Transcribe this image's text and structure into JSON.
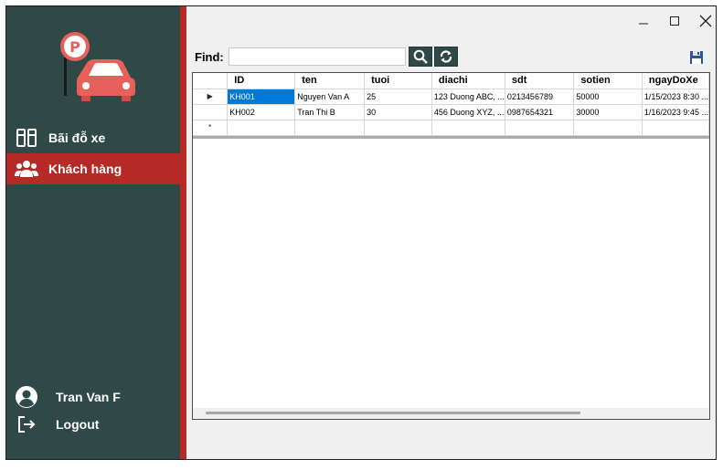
{
  "sidebar": {
    "items": [
      {
        "label": "Bãi đỗ xe",
        "icon": "parking-lot-icon",
        "active": false
      },
      {
        "label": "Khách hàng",
        "icon": "customers-icon",
        "active": true
      }
    ],
    "user_name": "Tran Van F",
    "logout_label": "Logout"
  },
  "toolbar": {
    "find_label": "Find:",
    "find_value": "",
    "search_icon": "search-icon",
    "refresh_icon": "refresh-icon",
    "save_icon": "save-icon"
  },
  "grid": {
    "columns": [
      "ID",
      "ten",
      "tuoi",
      "diachi",
      "sdt",
      "sotien",
      "ngayDoXe"
    ],
    "rows": [
      [
        "KH001",
        "Nguyen Van A",
        "25",
        "123 Duong ABC, ...",
        "0213456789",
        "50000",
        "1/15/2023 8:30 ..."
      ],
      [
        "KH002",
        "Tran Thi B",
        "30",
        "456 Duong XYZ, ...",
        "0987654321",
        "30000",
        "1/16/2023 9:45 ..."
      ]
    ],
    "selected_row": 0,
    "current_row_marker": "▶",
    "new_row_marker": "*"
  },
  "colors": {
    "sidebar_bg": "#2f4a46",
    "accent_red": "#b52a26",
    "selection_blue": "#0078d7"
  }
}
